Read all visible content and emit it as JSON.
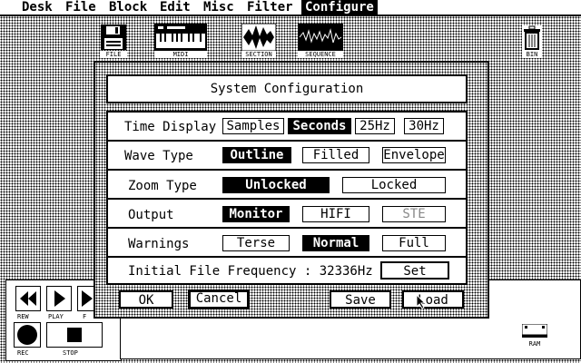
{
  "menu": [
    "Desk",
    "File",
    "Block",
    "Edit",
    "Misc",
    "Filter",
    "Configure"
  ],
  "desktop_icons": {
    "file": "FILE",
    "midi": "MIDI",
    "section": "SECTION",
    "sequence": "SEQUENCE",
    "bin": "BIN",
    "ram": "RAM"
  },
  "transport": {
    "rew": "REW",
    "play": "PLAY",
    "f": "F",
    "rec": "REC",
    "stop": "STOP"
  },
  "dialog": {
    "title": "System Configuration",
    "rows": [
      {
        "label": "Time Display",
        "options": [
          "Samples",
          "Seconds",
          "25Hz",
          "30Hz"
        ],
        "selected": "Seconds"
      },
      {
        "label": "Wave Type",
        "options": [
          "Outline",
          "Filled",
          "Envelope"
        ],
        "selected": "Outline"
      },
      {
        "label": "Zoom Type",
        "options": [
          "Unlocked",
          "Locked"
        ],
        "selected": "Unlocked"
      },
      {
        "label": "Output",
        "options": [
          "Monitor",
          "HIFI",
          "STE"
        ],
        "selected": "Monitor",
        "disabled": "STE"
      },
      {
        "label": "Warnings",
        "options": [
          "Terse",
          "Normal",
          "Full"
        ],
        "selected": "Normal"
      }
    ],
    "frequency_label": "Initial File Frequency : 32336Hz",
    "set_label": "Set",
    "ok_label": "OK",
    "cancel_label": "Cancel",
    "save_label": "Save",
    "load_label": "Load"
  }
}
